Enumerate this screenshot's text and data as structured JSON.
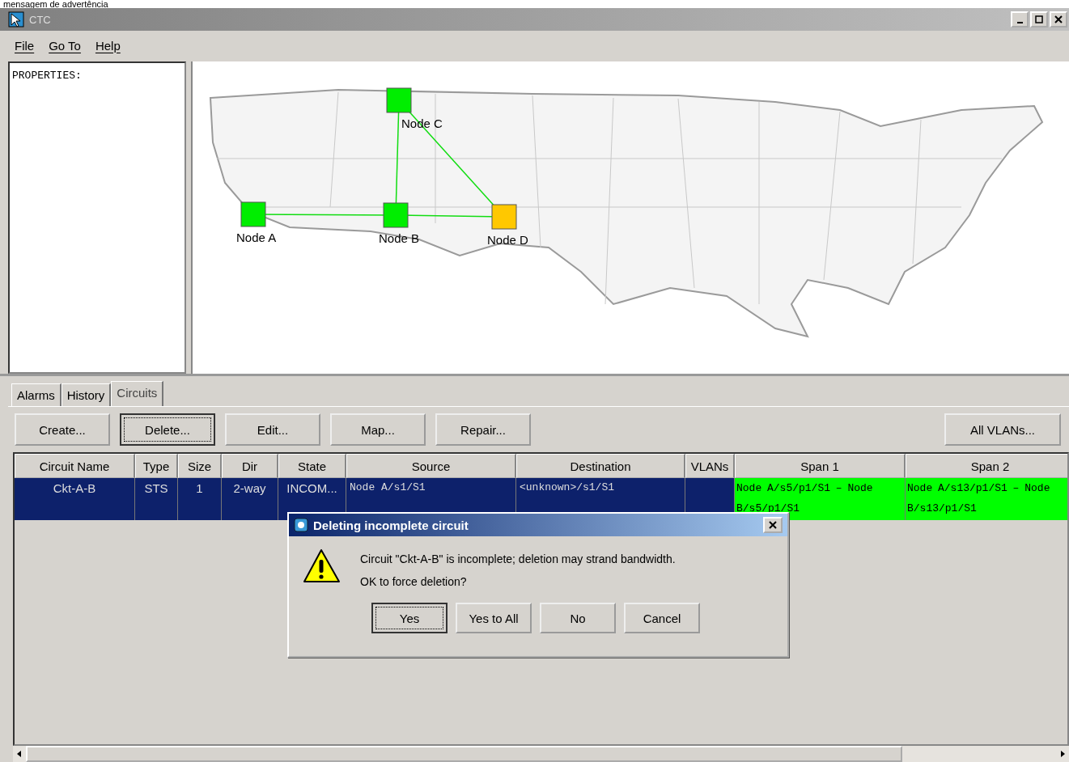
{
  "caption": "mensagem de advertência",
  "window": {
    "title": "CTC"
  },
  "menu": [
    "File",
    "Go To",
    "Help"
  ],
  "properties": {
    "label": "PROPERTIES:"
  },
  "map": {
    "nodes": [
      {
        "label": "Node C",
        "color": "#00ee00"
      },
      {
        "label": "Node A",
        "color": "#00ee00"
      },
      {
        "label": "Node B",
        "color": "#00ee00"
      },
      {
        "label": "Node D",
        "color": "#ffc800"
      }
    ]
  },
  "tabs": [
    {
      "label": "Alarms",
      "selected": false
    },
    {
      "label": "History",
      "selected": false
    },
    {
      "label": "Circuits",
      "selected": true
    }
  ],
  "toolbar": [
    {
      "label": "Create...",
      "focused": false
    },
    {
      "label": "Delete...",
      "focused": true
    },
    {
      "label": "Edit...",
      "focused": false
    },
    {
      "label": "Map...",
      "focused": false
    },
    {
      "label": "Repair...",
      "focused": false
    }
  ],
  "toolbar_right": {
    "label": "All VLANs..."
  },
  "table": {
    "columns": [
      "Circuit Name",
      "Type",
      "Size",
      "Dir",
      "State",
      "Source",
      "Destination",
      "VLANs",
      "Span 1",
      "Span 2"
    ],
    "rows": [
      {
        "selected": true,
        "cells": [
          {
            "text": "Ckt-A-B"
          },
          {
            "text": "STS"
          },
          {
            "text": "1"
          },
          {
            "text": "2-way"
          },
          {
            "text": "INCOM..."
          },
          {
            "text": "Node A/s1/S1",
            "kind": "mono"
          },
          {
            "text": "<unknown>/s1/S1",
            "kind": "mono"
          },
          {
            "kind": "blank"
          },
          {
            "text": "Node A/s5/p1/S1 – Node B/s5/p1/S1",
            "kind": "mono",
            "color": "#00ff00"
          },
          {
            "text": "Node A/s13/p1/S1 – Node B/s13/p1/S1",
            "kind": "mono",
            "color": "#00ff00"
          }
        ]
      }
    ]
  },
  "dialog": {
    "title": "Deleting incomplete circuit",
    "message": "Circuit \"Ckt-A-B\" is incomplete; deletion may strand bandwidth.",
    "question": "OK to force deletion?",
    "buttons": [
      {
        "label": "Yes",
        "focused": true
      },
      {
        "label": "Yes to All",
        "focused": false
      },
      {
        "label": "No",
        "focused": false
      },
      {
        "label": "Cancel",
        "focused": false
      }
    ]
  }
}
